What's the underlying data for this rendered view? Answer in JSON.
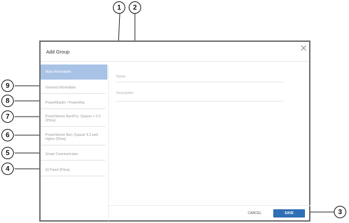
{
  "dialog": {
    "title": "Add Group",
    "close_icon": "close-icon",
    "sidebar": {
      "items": [
        {
          "label": "Main Information",
          "active": true
        },
        {
          "label": "General Information"
        },
        {
          "label": "PowerMaster / PowerMax"
        },
        {
          "label": "PowerSeries Neo/Pro, Quazar < 5.3 (Pima)"
        },
        {
          "label": "PowerSeries Neo, Quazar 5.3 and higher (Pima)"
        },
        {
          "label": "Smart Communicator"
        },
        {
          "label": "iQ Panel (Pima)"
        }
      ]
    },
    "fields": {
      "name_label": "Name",
      "description_label": "Description"
    },
    "buttons": {
      "cancel_label": "CANCEL",
      "save_label": "SAVE"
    },
    "colors": {
      "active_item_bg": "#a9c3e6",
      "save_button_bg": "#2f6fb5",
      "border": "#6e6e6e"
    }
  },
  "callouts": [
    "1",
    "2",
    "3",
    "4",
    "5",
    "6",
    "7",
    "8",
    "9"
  ]
}
